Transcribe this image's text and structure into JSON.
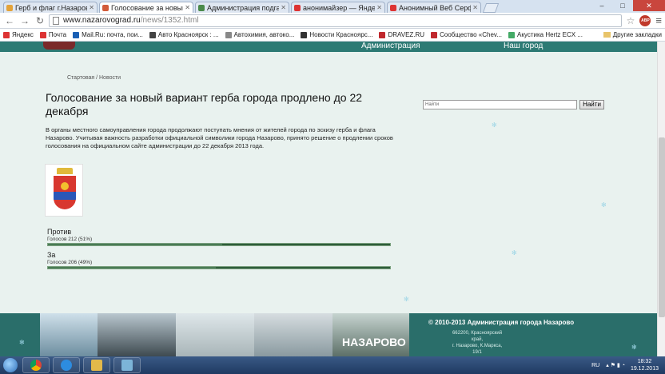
{
  "browser": {
    "tabs": [
      {
        "title": "Герб и флаг г.Назарово",
        "color": "#e4a33a",
        "active": false
      },
      {
        "title": "Голосование за новый вз",
        "color": "#d25b3a",
        "active": true
      },
      {
        "title": "Администрация подгасс",
        "color": "#4a8a4a",
        "active": false
      },
      {
        "title": "анонимайзер — Яндекс",
        "color": "#d33",
        "active": false
      },
      {
        "title": "Анонимный Веб Серфинг",
        "color": "#d33",
        "active": false
      }
    ],
    "url_host": "www.nazarovograd.ru",
    "url_path": "/news/1352.html",
    "abp_label": "ABP",
    "bookmarks": [
      {
        "label": "Яндекс",
        "color": "#d33"
      },
      {
        "label": "Почта",
        "color": "#d33"
      },
      {
        "label": "Mail.Ru: почта, пои...",
        "color": "#1a5fb4"
      },
      {
        "label": "Авто Красноярск : ...",
        "color": "#444"
      },
      {
        "label": "Автохимия, автоко...",
        "color": "#888"
      },
      {
        "label": "Новости Красноярс...",
        "color": "#333"
      },
      {
        "label": "DRAVEZ.RU",
        "color": "#c0282d"
      },
      {
        "label": "Сообщество «Chev...",
        "color": "#c0282d"
      },
      {
        "label": "Акустика Hertz ECX ...",
        "color": "#4a6"
      }
    ],
    "other_bookmarks": "Другие закладки"
  },
  "site": {
    "nav": {
      "admin": "Администрация",
      "city": "Наш город"
    },
    "breadcrumb": "Стартовая / Новости",
    "title": "Голосование за новый вариант герба города продлено до 22 декабря",
    "search": {
      "value": "Найти",
      "button": "Найти"
    },
    "intro": "В органы местного самоуправления города продолжают поступать мнения от жителей города по эскизу герба и флага Назарово. Учитывая важность разработки официальной символики города Назарово, принято решение о продлении сроков голосования на официальном сайте администрации до 22 декабря 2013 года.",
    "votes": [
      {
        "label": "Против",
        "count_text": "Голосов 212 (51%)",
        "percent": 51
      },
      {
        "label": "За",
        "count_text": "Голосов 206 (49%)",
        "percent": 49
      }
    ],
    "footer": {
      "copyright": "© 2010-2013 Администрация города Назарово",
      "address_line1": "662200, Красноярский край,",
      "address_line2": "г. Назарово, К.Маркса, 19/1",
      "photo_text": "НАЗАРОВО"
    }
  },
  "taskbar": {
    "lang": "RU",
    "time": "18:32",
    "date": "19.12.2013"
  }
}
